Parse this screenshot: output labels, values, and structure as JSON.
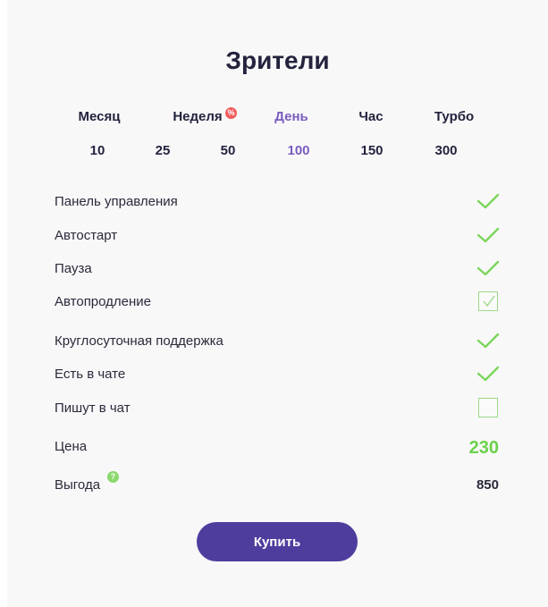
{
  "title": "Зрители",
  "periods": [
    {
      "label": "Месяц",
      "active": false
    },
    {
      "label": "Неделя",
      "active": false,
      "badge": "%"
    },
    {
      "label": "День",
      "active": true
    },
    {
      "label": "Час",
      "active": false
    },
    {
      "label": "Турбо",
      "active": false
    }
  ],
  "amounts": [
    {
      "label": "10",
      "active": false
    },
    {
      "label": "25",
      "active": false
    },
    {
      "label": "50",
      "active": false
    },
    {
      "label": "100",
      "active": true
    },
    {
      "label": "150",
      "active": false
    },
    {
      "label": "300",
      "active": false
    }
  ],
  "features": [
    {
      "label": "Панель управления",
      "state": "check"
    },
    {
      "label": "Автостарт",
      "state": "check"
    },
    {
      "label": "Пауза",
      "state": "check"
    },
    {
      "label": "Автопродление",
      "state": "checkbox-checked"
    },
    {
      "label": "Круглосуточная поддержка",
      "state": "check"
    },
    {
      "label": "Есть в чате",
      "state": "check"
    },
    {
      "label": "Пишут в чат",
      "state": "checkbox-unchecked"
    }
  ],
  "price": {
    "label": "Цена",
    "value": "230"
  },
  "benefit": {
    "label": "Выгода",
    "value": "850",
    "help_icon": "?"
  },
  "buy_label": "Купить",
  "colors": {
    "accent": "#4f3d9e",
    "active_tab": "#7a5cc0",
    "check": "#6ad24a",
    "badge": "#f05d5d"
  }
}
